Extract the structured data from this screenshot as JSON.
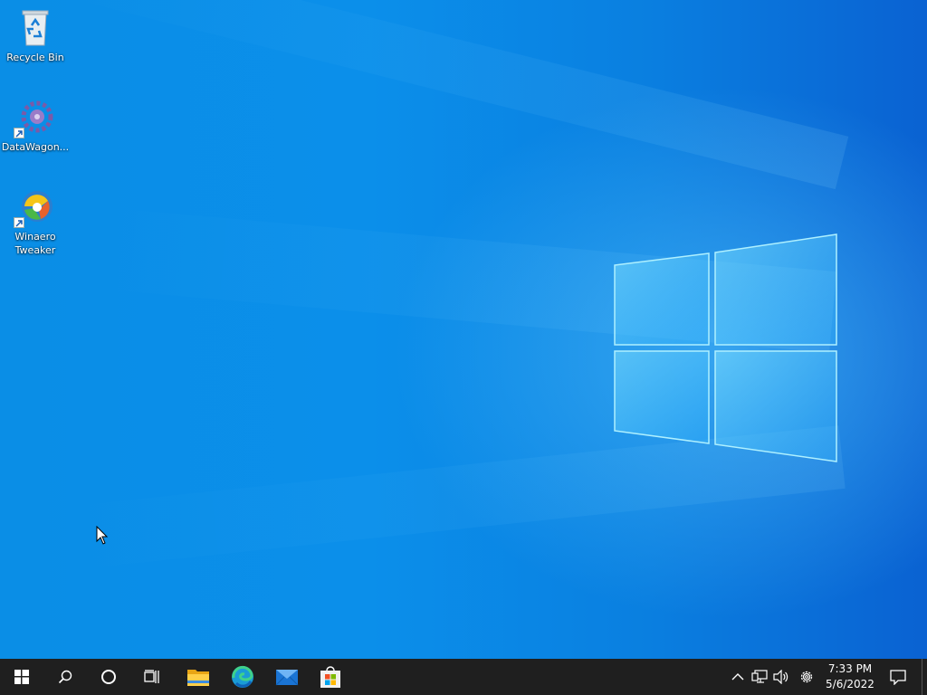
{
  "desktop": {
    "icons": [
      {
        "label": "Recycle Bin",
        "icon": "recycle-bin-icon",
        "shortcut": false
      },
      {
        "label": "DataWagon...",
        "icon": "datawagon-icon",
        "shortcut": true
      },
      {
        "label": "Winaero Tweaker",
        "icon": "winaero-tweaker-icon",
        "shortcut": true
      }
    ]
  },
  "taskbar": {
    "start_icon": "windows-logo-icon",
    "search_icon": "search-icon",
    "cortana_icon": "cortana-icon",
    "taskview_icon": "task-view-icon",
    "pinned": [
      {
        "name": "File Explorer",
        "icon": "file-explorer-icon"
      },
      {
        "name": "Microsoft Edge",
        "icon": "edge-icon"
      },
      {
        "name": "Mail",
        "icon": "mail-icon"
      },
      {
        "name": "Microsoft Store",
        "icon": "store-icon"
      }
    ],
    "tray": {
      "icons": [
        "chevron-up-icon",
        "network-icon",
        "volume-icon",
        "settings-gear-icon"
      ]
    },
    "clock": {
      "time": "7:33 PM",
      "date": "5/6/2022"
    },
    "notification_icon": "action-center-icon"
  },
  "colors": {
    "desktop_accent": "#0a8ee6",
    "taskbar_bg": "#1f1f1f",
    "logo_glow": "#5ac8ff"
  }
}
